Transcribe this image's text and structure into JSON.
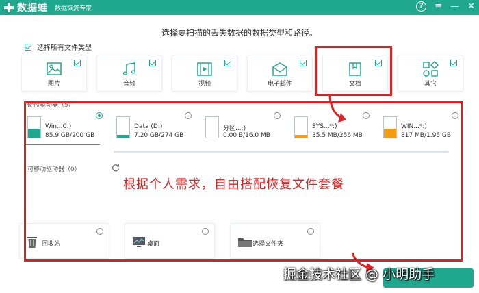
{
  "app": {
    "name": "数据蛙",
    "subtitle": "数据恢复专家"
  },
  "window_controls": {
    "help": "?",
    "menu": "≡",
    "minimize": "—",
    "close": "✕"
  },
  "prompt": "选择要扫描的丢失数据的数据类型和路径。",
  "select_all": {
    "label": "选择所有文件类型",
    "checked": true
  },
  "file_types": [
    {
      "label": "图片",
      "icon": "image-icon",
      "checked": true
    },
    {
      "label": "音频",
      "icon": "music-icon",
      "checked": true
    },
    {
      "label": "视频",
      "icon": "video-icon",
      "checked": true
    },
    {
      "label": "电子邮件",
      "icon": "email-icon",
      "checked": true
    },
    {
      "label": "文档",
      "icon": "document-icon",
      "checked": true
    },
    {
      "label": "其它",
      "icon": "other-icon",
      "checked": true
    }
  ],
  "hard_drives": {
    "title": "硬盘驱动器（5）",
    "items": [
      {
        "name": "Win...C:)",
        "size": "85.9 GB/200 GB",
        "selected": true,
        "fill_color": "#1fa88e",
        "usage": 0.43
      },
      {
        "name": "Data (D:)",
        "size": "7.20 GB/274 GB",
        "selected": false,
        "fill_color": "#1fa88e",
        "usage": 0.03
      },
      {
        "name": "分区...:)",
        "size": "0.00  B/16.0 MB",
        "selected": false,
        "fill_color": "#f39c12",
        "usage": 0.0
      },
      {
        "name": "SYS...*:)",
        "size": "35.5 MB/256 MB",
        "selected": false,
        "fill_color": "#f39c12",
        "usage": 0.14
      },
      {
        "name": "WIN...*:)",
        "size": "817 MB/1.95 GB",
        "selected": false,
        "fill_color": "#f39c12",
        "usage": 0.42
      }
    ]
  },
  "removable": {
    "title": "可移动驱动器（0）"
  },
  "locations": [
    {
      "label": "回收站",
      "icon": "recycle-bin-icon"
    },
    {
      "label": "桌面",
      "icon": "desktop-icon"
    },
    {
      "label": "选择文件夹",
      "icon": "folder-icon"
    }
  ],
  "annotation": "根据个人需求，自由搭配恢复文件套餐",
  "watermark": "掘金技术社区 @ 小明助手",
  "colors": {
    "brand": "#1fa88e",
    "annotation": "#e02020",
    "warning": "#f39c12"
  }
}
